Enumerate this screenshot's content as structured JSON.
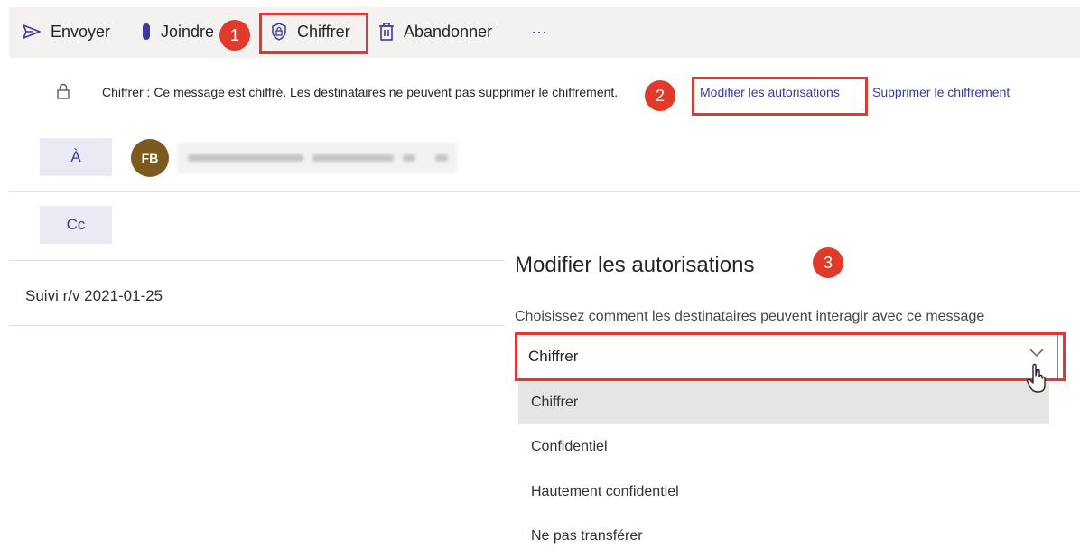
{
  "toolbar": {
    "send_label": "Envoyer",
    "attach_label": "Joindre",
    "encrypt_label": "Chiffrer",
    "discard_label": "Abandonner",
    "more_label": "···"
  },
  "annotations": {
    "step1": "1",
    "step2": "2",
    "step3": "3",
    "highlight_color": "#e4372f"
  },
  "infobar": {
    "message": "Chiffrer : Ce message est chiffré. Les destinataires ne peuvent pas supprimer le chiffrement.",
    "change_permissions_link": "Modifier les autorisations",
    "remove_encryption_link": "Supprimer le chiffrement"
  },
  "recipients": {
    "to_label": "À",
    "cc_label": "Cc",
    "to_avatar_initials": "FB"
  },
  "subject": "Suivi r/v 2021-01-25",
  "permissions_panel": {
    "title": "Modifier les autorisations",
    "subtitle": "Choisissez comment les destinataires peuvent interagir avec ce message",
    "selected_value": "Chiffrer",
    "options": [
      {
        "label": "Chiffrer",
        "selected": true
      },
      {
        "label": "Confidentiel",
        "selected": false
      },
      {
        "label": "Hautement confidentiel",
        "selected": false
      },
      {
        "label": "Ne pas transférer",
        "selected": false
      }
    ]
  },
  "colors": {
    "accent": "#3b3a9e",
    "badge": "#e13a2b",
    "toolbar_bg": "#f3f2f1"
  }
}
